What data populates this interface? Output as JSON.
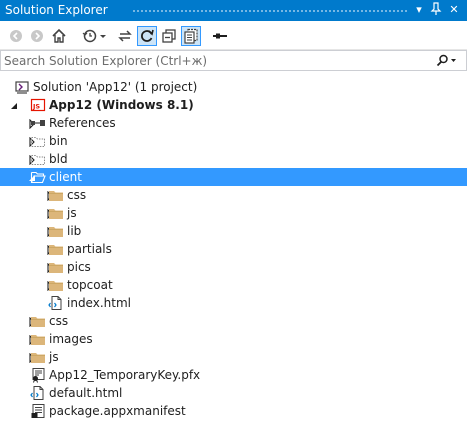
{
  "titlebar": {
    "title": "Solution Explorer",
    "dropdown_glyph": "▾",
    "pin_glyph": "ᚼ",
    "close_glyph": "✕"
  },
  "toolbar": {
    "buttons": [
      {
        "name": "back-button",
        "icon": "back-arrow-icon"
      },
      {
        "name": "forward-button",
        "icon": "forward-arrow-icon"
      },
      {
        "name": "home-button",
        "icon": "home-icon"
      },
      {
        "name": "pending-changes-filter-button",
        "icon": "clock-filter-icon"
      },
      {
        "name": "sync-with-active-document-button",
        "icon": "sync-icon"
      },
      {
        "name": "refresh-button",
        "icon": "refresh-icon",
        "checked": true
      },
      {
        "name": "collapse-all-button",
        "icon": "collapse-all-icon"
      },
      {
        "name": "show-all-files-button",
        "icon": "show-all-files-icon",
        "checked": true
      },
      {
        "name": "properties-button",
        "icon": "properties-icon"
      }
    ]
  },
  "search": {
    "placeholder": "Search Solution Explorer (Ctrl+ж)"
  },
  "tree": [
    {
      "label": "Solution 'App12' (1 project)",
      "icon": "solution",
      "level": 0,
      "expander": "none"
    },
    {
      "label": "App12 (Windows 8.1)",
      "icon": "js-project",
      "level": 0,
      "expander": "expanded",
      "bold": true
    },
    {
      "label": "References",
      "icon": "references",
      "level": 1,
      "expander": "collapsed"
    },
    {
      "label": "bin",
      "icon": "folder-hidden",
      "level": 1,
      "expander": "collapsed"
    },
    {
      "label": "bld",
      "icon": "folder-hidden",
      "level": 1,
      "expander": "collapsed"
    },
    {
      "label": "client",
      "icon": "folder-open",
      "level": 1,
      "expander": "expanded",
      "selected": true
    },
    {
      "label": "css",
      "icon": "folder",
      "level": 2,
      "expander": "collapsed"
    },
    {
      "label": "js",
      "icon": "folder",
      "level": 2,
      "expander": "collapsed"
    },
    {
      "label": "lib",
      "icon": "folder",
      "level": 2,
      "expander": "collapsed"
    },
    {
      "label": "partials",
      "icon": "folder",
      "level": 2,
      "expander": "collapsed"
    },
    {
      "label": "pics",
      "icon": "folder",
      "level": 2,
      "expander": "collapsed"
    },
    {
      "label": "topcoat",
      "icon": "folder",
      "level": 2,
      "expander": "collapsed"
    },
    {
      "label": "index.html",
      "icon": "html-file",
      "level": 2,
      "expander": "none"
    },
    {
      "label": "css",
      "icon": "folder",
      "level": 1,
      "expander": "collapsed"
    },
    {
      "label": "images",
      "icon": "folder",
      "level": 1,
      "expander": "collapsed"
    },
    {
      "label": "js",
      "icon": "folder",
      "level": 1,
      "expander": "collapsed"
    },
    {
      "label": "App12_TemporaryKey.pfx",
      "icon": "certificate-file",
      "level": 1,
      "expander": "none"
    },
    {
      "label": "default.html",
      "icon": "html-file",
      "level": 1,
      "expander": "none"
    },
    {
      "label": "package.appxmanifest",
      "icon": "manifest-file",
      "level": 1,
      "expander": "none"
    }
  ],
  "colors": {
    "accent": "#007acc",
    "selection": "#3399ff",
    "folder": "#dcb67a",
    "js_badge": "#e51400"
  }
}
